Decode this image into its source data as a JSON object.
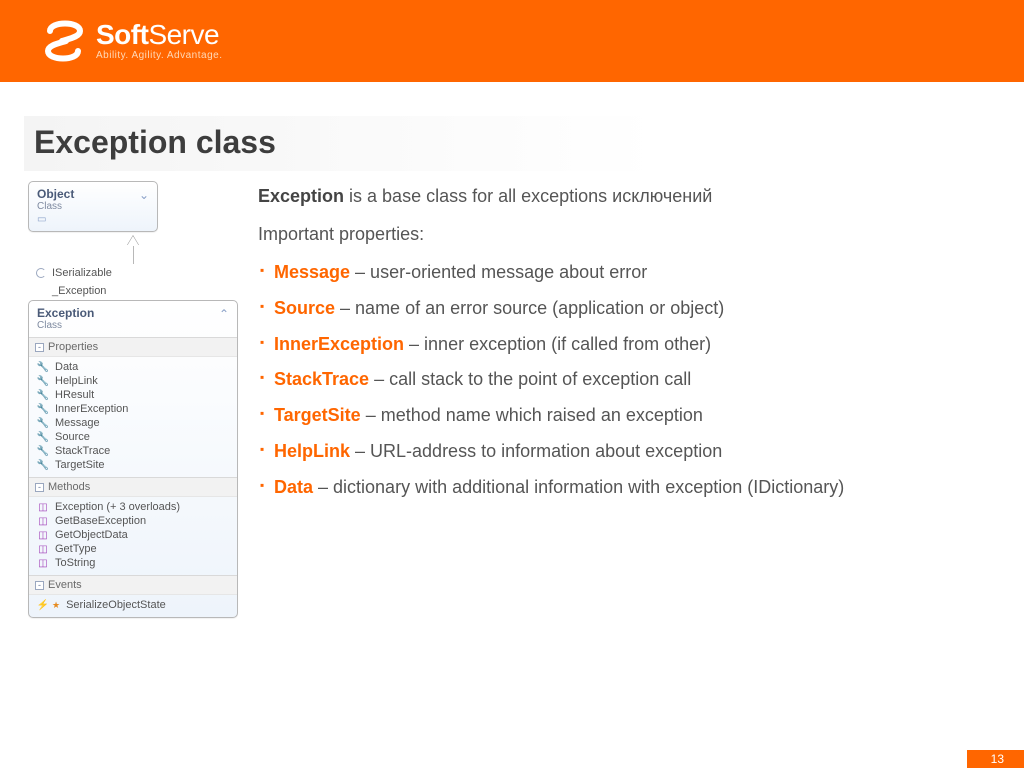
{
  "brand": {
    "name_bold": "Soft",
    "name_thin": "Serve",
    "tagline": "Ability. Agility. Advantage."
  },
  "title": "Exception class",
  "intro": {
    "lead_word": "Exception",
    "lead_rest": " is a base class for all exceptions исключений",
    "subhead": "Important properties:"
  },
  "bullets": [
    {
      "term": "Message",
      "desc": " – user-oriented message about error"
    },
    {
      "term": "Source",
      "desc": " – name of an error source (application or object)"
    },
    {
      "term": "InnerException",
      "desc": " – inner exception (if called from other)"
    },
    {
      "term": "StackTrace",
      "desc": " – call stack to the point of exception call"
    },
    {
      "term": "TargetSite",
      "desc": " – method name which raised an exception"
    },
    {
      "term": "HelpLink",
      "desc": " – URL-address to information about exception"
    },
    {
      "term": "Data",
      "desc": " – dictionary with additional information with exception (IDictionary)"
    }
  ],
  "diagram": {
    "object_box": {
      "name": "Object",
      "type": "Class"
    },
    "interfaces": [
      "ISerializable",
      "_Exception"
    ],
    "exception_box": {
      "name": "Exception",
      "type": "Class"
    },
    "sections": {
      "properties_label": "Properties",
      "methods_label": "Methods",
      "events_label": "Events"
    },
    "properties": [
      "Data",
      "HelpLink",
      "HResult",
      "InnerException",
      "Message",
      "Source",
      "StackTrace",
      "TargetSite"
    ],
    "methods": [
      "Exception (+ 3 overloads)",
      "GetBaseException",
      "GetObjectData",
      "GetType",
      "ToString"
    ],
    "events": [
      "SerializeObjectState"
    ]
  },
  "page_number": "13"
}
